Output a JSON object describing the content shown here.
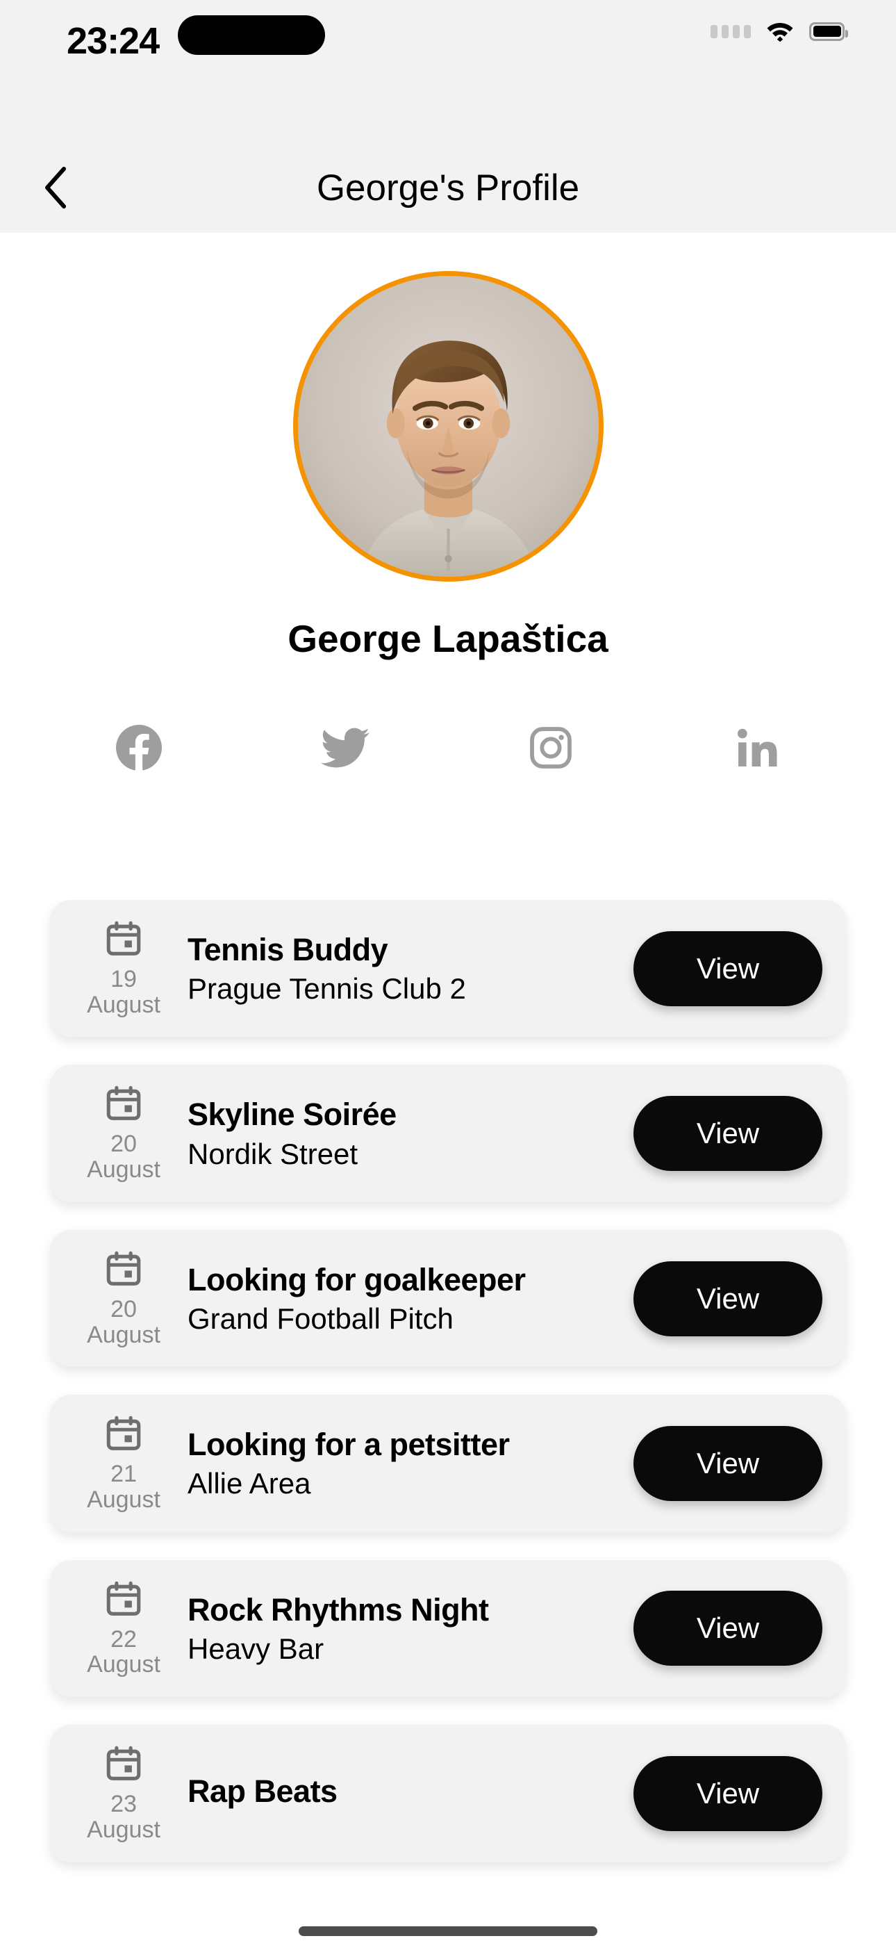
{
  "status_bar": {
    "time": "23:24",
    "signal_icon": "signal-dots-icon",
    "wifi_icon": "wifi-icon",
    "battery_icon": "battery-icon"
  },
  "header": {
    "back_icon": "chevron-left-icon",
    "title": "George's Profile"
  },
  "profile": {
    "avatar_name": "profile-avatar-photo",
    "avatar_ring_color": "#f59200",
    "name": "George Lapaštica"
  },
  "social_links": [
    {
      "name": "facebook",
      "icon": "facebook-icon",
      "color": "#9e9e9e"
    },
    {
      "name": "twitter",
      "icon": "twitter-icon",
      "color": "#9e9e9e"
    },
    {
      "name": "instagram",
      "icon": "instagram-icon",
      "color": "#9e9e9e"
    },
    {
      "name": "linkedin",
      "icon": "linkedin-icon",
      "color": "#9e9e9e"
    }
  ],
  "events": [
    {
      "day": "19",
      "month": "August",
      "title": "Tennis Buddy",
      "place": "Prague Tennis Club 2",
      "action": "View"
    },
    {
      "day": "20",
      "month": "August",
      "title": "Skyline Soirée",
      "place": "Nordik Street",
      "action": "View"
    },
    {
      "day": "20",
      "month": "August",
      "title": "Looking for goalkeeper",
      "place": "Grand Football Pitch",
      "action": "View"
    },
    {
      "day": "21",
      "month": "August",
      "title": "Looking for a petsitter",
      "place": "Allie Area",
      "action": "View"
    },
    {
      "day": "22",
      "month": "August",
      "title": "Rock Rhythms Night",
      "place": "Heavy Bar",
      "action": "View"
    },
    {
      "day": "23",
      "month": "August",
      "title": "Rap Beats",
      "place": "",
      "action": "View"
    }
  ],
  "colors": {
    "page_background": "#ffffff",
    "chrome_background": "#f2f2f2",
    "card_background": "#f2f2f2",
    "button_background": "#0a0a0a",
    "button_text": "#ffffff",
    "muted_text": "#8a8a8a",
    "accent": "#f59200"
  }
}
